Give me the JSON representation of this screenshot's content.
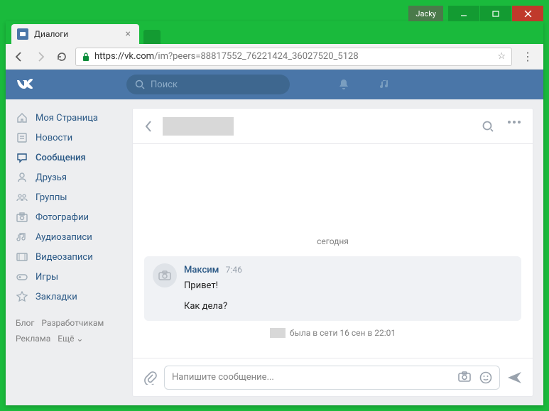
{
  "window": {
    "profile": "Jacky"
  },
  "tab": {
    "title": "Диалоги"
  },
  "address": {
    "host": "https://vk.com",
    "path": "/im?peers=88817552_76221424_36027520_5128"
  },
  "vk": {
    "search_placeholder": "Поиск",
    "sidebar": [
      {
        "label": "Моя Страница",
        "icon": "home"
      },
      {
        "label": "Новости",
        "icon": "news"
      },
      {
        "label": "Сообщения",
        "icon": "messages"
      },
      {
        "label": "Друзья",
        "icon": "friends"
      },
      {
        "label": "Группы",
        "icon": "groups"
      },
      {
        "label": "Фотографии",
        "icon": "photos"
      },
      {
        "label": "Аудиозаписи",
        "icon": "audio"
      },
      {
        "label": "Видеозаписи",
        "icon": "video"
      },
      {
        "label": "Игры",
        "icon": "games"
      },
      {
        "label": "Закладки",
        "icon": "bookmarks"
      }
    ],
    "footer": [
      "Блог",
      "Разработчикам",
      "Реклама",
      "Ещё ⌄"
    ]
  },
  "dialog": {
    "date_label": "сегодня",
    "message": {
      "sender": "Максим",
      "time": "7:46",
      "lines": [
        "Привет!",
        "Как дела?"
      ]
    },
    "status": "была в сети 16 сен в 22:01",
    "compose_placeholder": "Напишите сообщение..."
  }
}
